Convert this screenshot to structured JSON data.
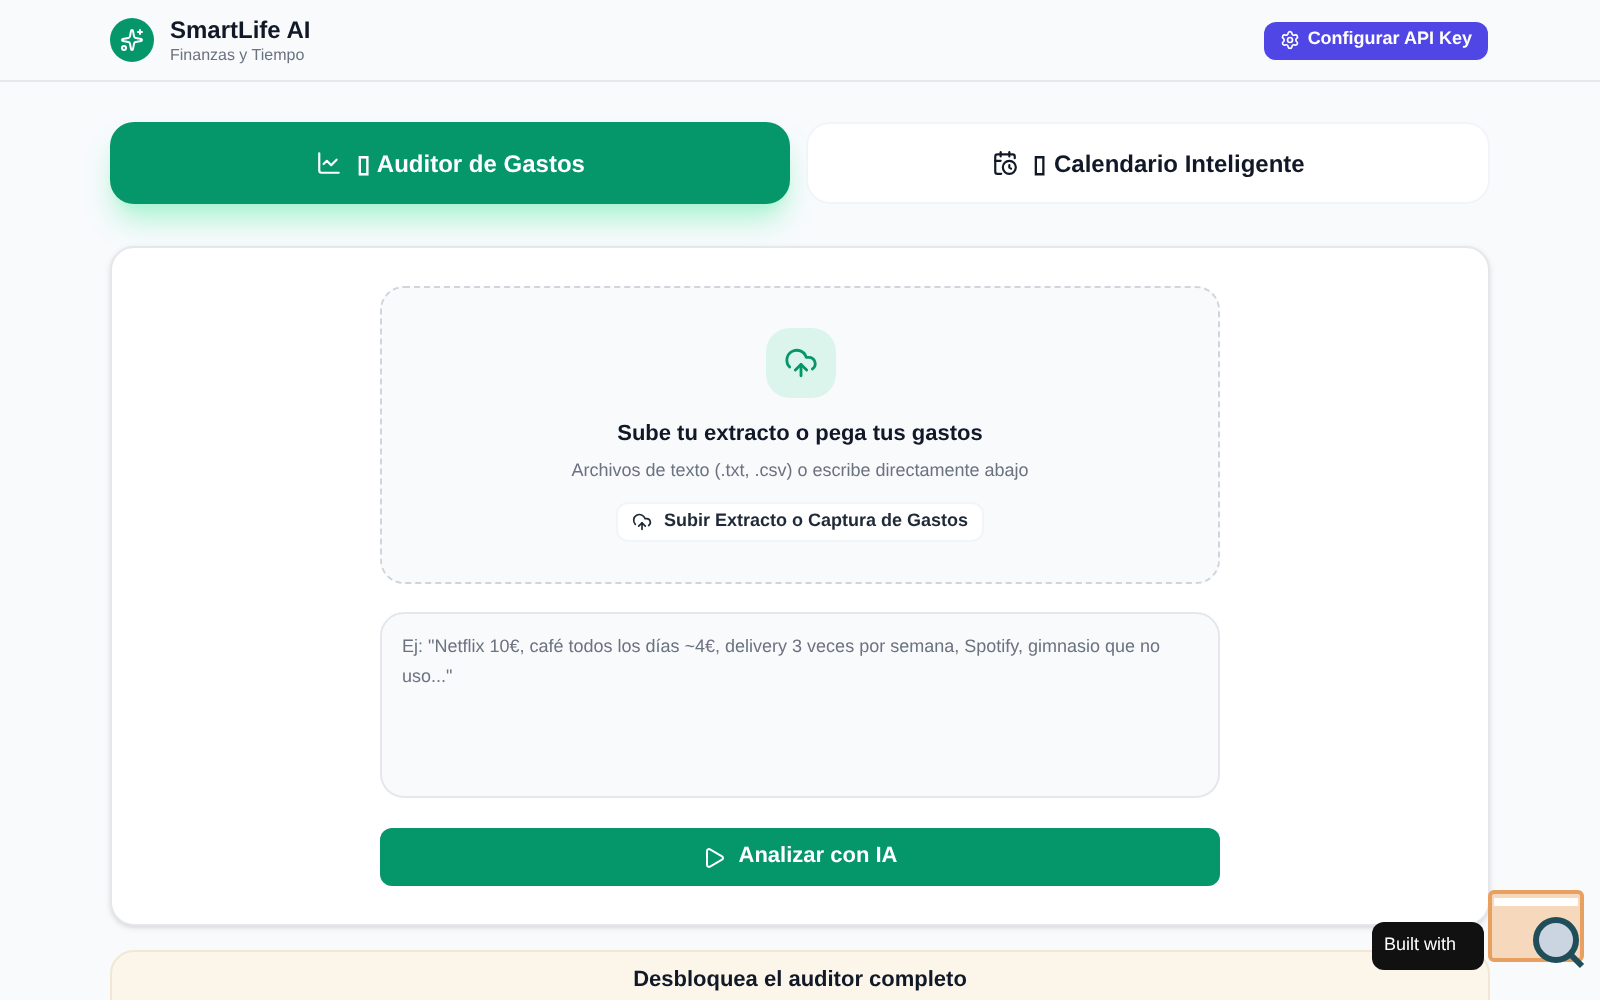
{
  "header": {
    "title": "SmartLife AI",
    "subtitle": "Finanzas y Tiempo",
    "api_button": "Configurar API Key"
  },
  "tabs": [
    {
      "kind": "chart",
      "label": "▯ Auditor de Gastos",
      "selected": true
    },
    {
      "kind": "calendar",
      "label": "▯ Calendario Inteligente",
      "selected": false
    }
  ],
  "upload": {
    "title": "Sube tu extracto o pega tus gastos",
    "hint": "Archivos de texto (.txt, .csv) o escribe directamente abajo",
    "button": "Subir Extracto o Captura de Gastos"
  },
  "expenses_field": {
    "placeholder": "Ej: \"Netflix 10€, café todos los días ~4€, delivery 3 veces por semana, Spotify, gimnasio que no uso...\""
  },
  "analyze_button": "Analizar con IA",
  "promo": {
    "title": "Desbloquea el auditor completo"
  },
  "badge": {
    "text": "Built with"
  }
}
